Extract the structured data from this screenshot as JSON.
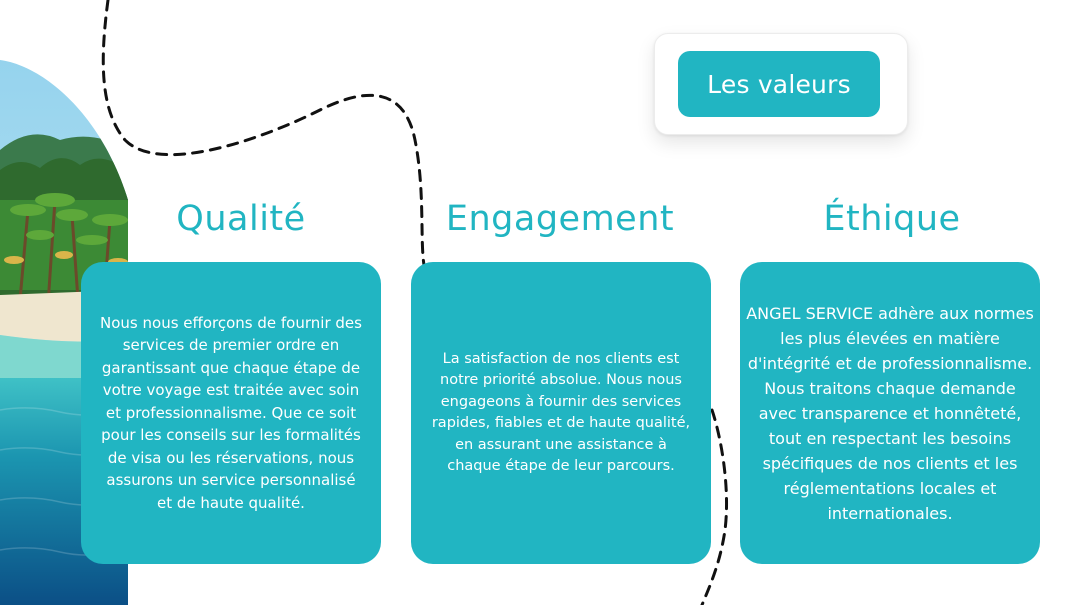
{
  "header": {
    "badge_label": "Les valeurs"
  },
  "columns": [
    {
      "title": "Qualité",
      "text": "Nous nous efforçons de fournir des services de premier ordre en garantissant que chaque étape de votre voyage est traitée avec soin et professionnalisme. Que ce soit pour les conseils sur les formalités de visa ou les réservations, nous assurons un service personnalisé et de haute qualité."
    },
    {
      "title": "Engagement",
      "text": "La satisfaction de nos clients est notre priorité absolue. Nous nous engageons à fournir des services rapides, fiables et de haute qualité, en assurant une assistance à chaque étape de leur parcours."
    },
    {
      "title": "Éthique",
      "text": "ANGEL SERVICE adhère aux normes les plus élevées en matière d'intégrité et de professionnalisme. Nous traitons chaque demande avec transparence et honnêteté, tout en respectant les besoins spécifiques de nos clients et les réglementations locales et internationales."
    }
  ],
  "colors": {
    "accent": "#21b5c2",
    "card_text": "#ffffff",
    "background": "#ffffff"
  },
  "decor": {
    "photo": "tropical-beach-photo",
    "path": "dashed-travel-path"
  }
}
